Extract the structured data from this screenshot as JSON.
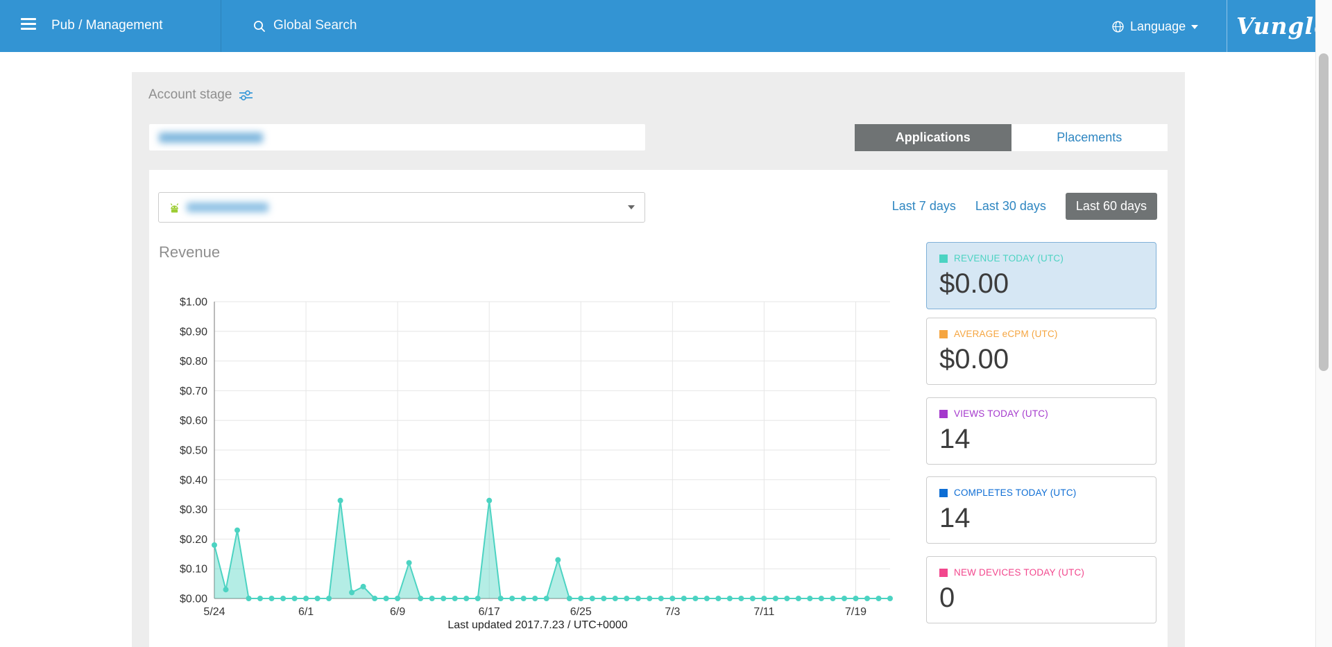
{
  "topbar": {
    "title": "Pub / Management",
    "search_placeholder": "Global Search",
    "language_label": "Language",
    "logo": "Vungle"
  },
  "filters": {
    "account_stage_label": "Account stage",
    "tabs": [
      {
        "label": "Applications",
        "active": true
      },
      {
        "label": "Placements",
        "active": false
      }
    ],
    "date_ranges": [
      {
        "label": "Last 7 days",
        "active": false
      },
      {
        "label": "Last 30 days",
        "active": false
      },
      {
        "label": "Last 60 days",
        "active": true
      }
    ]
  },
  "chart_section": {
    "title": "Revenue",
    "last_updated": "Last updated 2017.7.23 / UTC+0000"
  },
  "stats": [
    {
      "label": "REVENUE TODAY (UTC)",
      "value": "$0.00",
      "color": "#4cd3c2",
      "highlighted": true
    },
    {
      "label": "AVERAGE eCPM (UTC)",
      "value": "$0.00",
      "color": "#f5a540",
      "highlighted": false
    },
    {
      "label": "VIEWS TODAY (UTC)",
      "value": "14",
      "color": "#a438cc",
      "highlighted": false
    },
    {
      "label": "COMPLETES TODAY (UTC)",
      "value": "14",
      "color": "#0d6dd4",
      "highlighted": false
    },
    {
      "label": "NEW DEVICES TODAY (UTC)",
      "value": "0",
      "color": "#f2478d",
      "highlighted": false
    }
  ],
  "chart_data": {
    "type": "area",
    "title": "Revenue",
    "x": [
      "5/24",
      "5/25",
      "5/26",
      "5/27",
      "5/28",
      "5/29",
      "5/30",
      "5/31",
      "6/1",
      "6/2",
      "6/3",
      "6/4",
      "6/5",
      "6/6",
      "6/7",
      "6/8",
      "6/9",
      "6/10",
      "6/11",
      "6/12",
      "6/13",
      "6/14",
      "6/15",
      "6/16",
      "6/17",
      "6/18",
      "6/19",
      "6/20",
      "6/21",
      "6/22",
      "6/23",
      "6/24",
      "6/25",
      "6/26",
      "6/27",
      "6/28",
      "6/29",
      "6/30",
      "7/1",
      "7/2",
      "7/3",
      "7/4",
      "7/5",
      "7/6",
      "7/7",
      "7/8",
      "7/9",
      "7/10",
      "7/11",
      "7/12",
      "7/13",
      "7/14",
      "7/15",
      "7/16",
      "7/17",
      "7/18",
      "7/19",
      "7/20",
      "7/21",
      "7/22"
    ],
    "values": [
      0.18,
      0.03,
      0.23,
      0,
      0,
      0,
      0,
      0,
      0,
      0,
      0,
      0.33,
      0.02,
      0.04,
      0,
      0,
      0,
      0.12,
      0,
      0,
      0,
      0,
      0,
      0,
      0.33,
      0,
      0,
      0,
      0,
      0,
      0.13,
      0,
      0,
      0,
      0,
      0,
      0,
      0,
      0,
      0,
      0,
      0,
      0,
      0,
      0,
      0,
      0,
      0,
      0,
      0,
      0,
      0,
      0,
      0,
      0,
      0,
      0,
      0,
      0,
      0
    ],
    "x_tick_labels": [
      "5/24",
      "6/1",
      "6/9",
      "6/17",
      "6/25",
      "7/3",
      "7/11",
      "7/19"
    ],
    "y_ticks": [
      "$0.00",
      "$0.10",
      "$0.20",
      "$0.30",
      "$0.40",
      "$0.50",
      "$0.60",
      "$0.70",
      "$0.80",
      "$0.90",
      "$1.00"
    ],
    "ylim": [
      0,
      1
    ],
    "grid": true,
    "line_color": "#4cd3c2",
    "legend_position": "none"
  }
}
